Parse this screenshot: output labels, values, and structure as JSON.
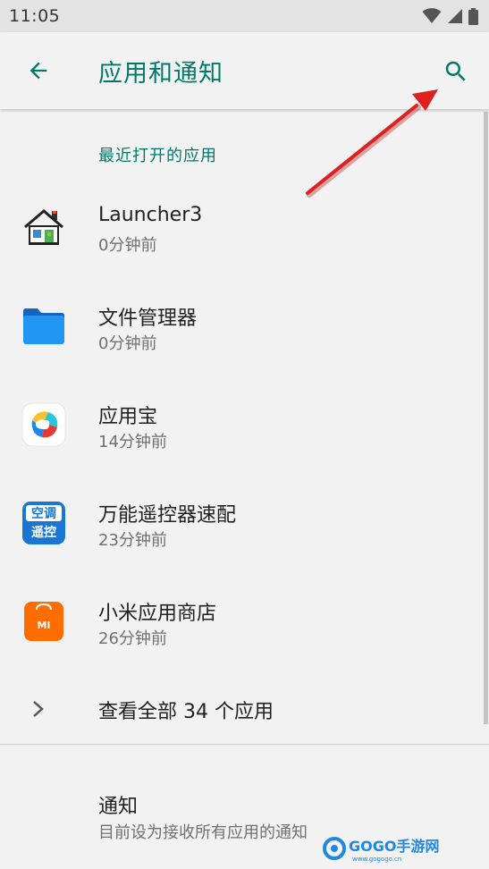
{
  "status_bar": {
    "time": "11:05",
    "icons": [
      "wifi-icon",
      "signal-icon",
      "battery-icon"
    ]
  },
  "app_bar": {
    "title": "应用和通知",
    "back_icon": "arrow-back-icon",
    "search_icon": "search-icon",
    "accent": "#00796b"
  },
  "recent_apps": {
    "header": "最近打开的应用",
    "items": [
      {
        "name": "Launcher3",
        "time": "0分钟前",
        "icon": "launcher-house-icon"
      },
      {
        "name": "文件管理器",
        "time": "0分钟前",
        "icon": "folder-icon"
      },
      {
        "name": "应用宝",
        "time": "14分钟前",
        "icon": "yingyongbao-icon"
      },
      {
        "name": "万能遥控器速配",
        "time": "23分钟前",
        "icon": "remote-control-icon"
      },
      {
        "name": "小米应用商店",
        "time": "26分钟前",
        "icon": "mi-store-icon"
      }
    ],
    "see_all": "查看全部 34 个应用"
  },
  "notifications": {
    "title": "通知",
    "summary": "目前设为接收所有应用的通知"
  },
  "remote_icon_text": {
    "top": "空调",
    "bottom": "遥控"
  },
  "mi_icon_text": "MI",
  "watermark": {
    "brand": "GOGO手游网",
    "url": "www.gogogo.cn"
  },
  "colors": {
    "annotation_arrow": "#e02020",
    "background": "#f2f2f2"
  }
}
